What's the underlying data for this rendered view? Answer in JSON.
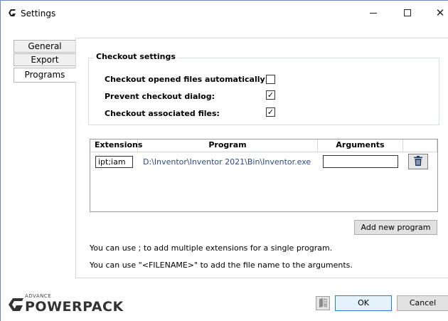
{
  "window": {
    "title": "Settings",
    "app_icon": "gear-logo-icon",
    "minimize_icon": "minimize-icon",
    "maximize_icon": "maximize-icon",
    "close_icon": "close-icon",
    "close_glyph": "✕"
  },
  "tabs": [
    {
      "label": "General",
      "selected": false
    },
    {
      "label": "Export",
      "selected": false
    },
    {
      "label": "Programs",
      "selected": true
    }
  ],
  "checkout": {
    "group_title": "Checkout settings",
    "options": [
      {
        "label": "Checkout opened files automatically:",
        "checked": false
      },
      {
        "label": "Prevent checkout dialog:",
        "checked": true
      },
      {
        "label": "Checkout associated files:",
        "checked": true
      }
    ],
    "check_glyph": "✓"
  },
  "programs_table": {
    "columns": [
      "Extensions",
      "Program",
      "Arguments",
      ""
    ],
    "rows": [
      {
        "extensions": "ipt;iam",
        "program": "D:\\Inventor\\Inventor 2021\\Bin\\Inventor.exe",
        "arguments": ""
      }
    ],
    "delete_icon": "trash-icon"
  },
  "add_program_label": "Add new program",
  "hints": [
    "You can use ; to add multiple extensions for a single program.",
    "You can use \"<FILENAME>\" to add the file name to the arguments."
  ],
  "footer": {
    "logo_small": "ADVANCE",
    "logo_main": "POWERPACK",
    "help_icon": "help-book-icon",
    "ok_label": "OK",
    "cancel_label": "Cancel"
  },
  "colors": {
    "accent": "#2a7ad6",
    "link_text": "#2a4b8d",
    "logo_gray": "#333333"
  }
}
